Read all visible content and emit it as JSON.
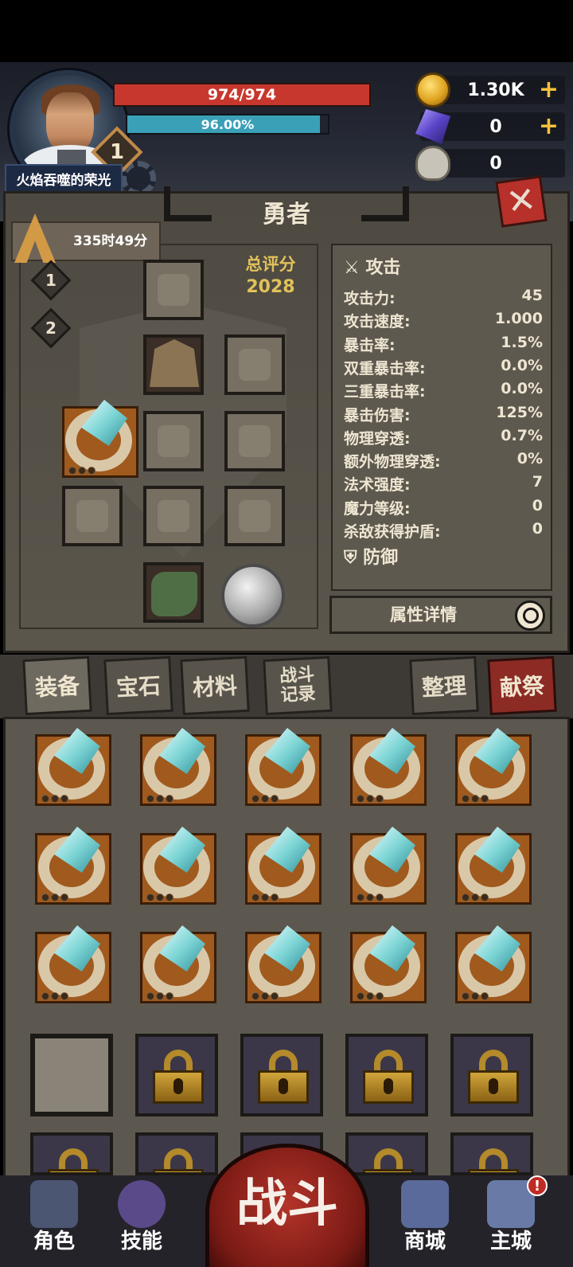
{
  "player": {
    "name": "火焰吞噬的荣光",
    "level": "1",
    "hp": "974/974",
    "mp": "96.00%",
    "mp_fraction": 0.96
  },
  "resources": {
    "gold": "1.30K",
    "crystal": "0",
    "skull": "0",
    "plus": "+"
  },
  "panel": {
    "title": "勇者",
    "timer": "335时49分",
    "tier1": "1",
    "tier2": "2",
    "score_label": "总评分",
    "score_value": "2028"
  },
  "stats": {
    "header": "攻击",
    "rows": [
      {
        "k": "攻击力:",
        "v": "45"
      },
      {
        "k": "攻击速度:",
        "v": "1.000"
      },
      {
        "k": "暴击率:",
        "v": "1.5%"
      },
      {
        "k": "双重暴击率:",
        "v": "0.0%"
      },
      {
        "k": "三重暴击率:",
        "v": "0.0%"
      },
      {
        "k": "暴击伤害:",
        "v": "125%"
      },
      {
        "k": "物理穿透:",
        "v": "0.7%"
      },
      {
        "k": "额外物理穿透:",
        "v": "0%"
      },
      {
        "k": "法术强度:",
        "v": "7"
      },
      {
        "k": "魔力等级:",
        "v": "0"
      },
      {
        "k": "杀敌获得护盾:",
        "v": "0"
      }
    ],
    "sub_header": "防御",
    "details_button": "属性详情"
  },
  "tabs": {
    "equipment": "装备",
    "gems": "宝石",
    "materials": "材料",
    "battle_log": "战斗记录",
    "sort": "整理",
    "sacrifice": "献祭"
  },
  "nav": {
    "character": "角色",
    "skills": "技能",
    "battle": "战斗",
    "shop": "商城",
    "main_city": "主城",
    "alert": "!"
  },
  "icons": {
    "gold": "coin-icon",
    "crystal": "crystal-icon",
    "skull": "ram-skull-icon",
    "close": "close-icon",
    "search": "search-icon",
    "lock": "lock-icon"
  },
  "colors": {
    "hp": "#c8372d",
    "mp": "#3aa0b8",
    "accent_gold": "#e2c25a",
    "sacrifice_red": "#8c2a24"
  }
}
